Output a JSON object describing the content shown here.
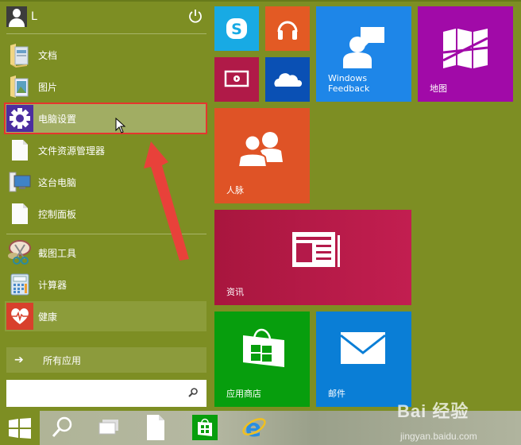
{
  "user": {
    "name": "L"
  },
  "pinned_items": [
    {
      "label": "文档",
      "icon": "documents-folder-icon"
    },
    {
      "label": "图片",
      "icon": "pictures-folder-icon"
    },
    {
      "label": "电脑设置",
      "icon": "gear-icon",
      "state": "selected"
    },
    {
      "label": "文件资源管理器",
      "icon": "document-icon"
    },
    {
      "label": "这台电脑",
      "icon": "computer-icon"
    },
    {
      "label": "控制面板",
      "icon": "document-icon"
    }
  ],
  "recent_items": [
    {
      "label": "截图工具",
      "icon": "scissors-icon"
    },
    {
      "label": "计算器",
      "icon": "calculator-icon"
    },
    {
      "label": "健康",
      "icon": "heart-icon",
      "state": "highlighted"
    }
  ],
  "all_apps": {
    "label": "所有应用"
  },
  "search": {
    "value": "",
    "placeholder": ""
  },
  "tiles": [
    {
      "id": "skype",
      "label": "",
      "color": "#18aae4",
      "icon": "skype-icon"
    },
    {
      "id": "music",
      "label": "",
      "color": "#e35a24",
      "icon": "headphones-icon"
    },
    {
      "id": "video",
      "label": "",
      "color": "#b01a48",
      "icon": "video-icon"
    },
    {
      "id": "onedrive",
      "label": "",
      "color": "#0a50b4",
      "icon": "cloud-icon"
    },
    {
      "id": "feedback",
      "label": "Windows Feedback",
      "color": "#1e86e8",
      "icon": "feedback-icon"
    },
    {
      "id": "maps",
      "label": "地图",
      "color": "#a10aa8",
      "icon": "map-icon"
    },
    {
      "id": "people",
      "label": "人脉",
      "color": "#df5326",
      "icon": "people-icon"
    },
    {
      "id": "news",
      "label": "资讯",
      "color": "#b41a4a",
      "icon": "news-icon"
    },
    {
      "id": "store",
      "label": "应用商店",
      "color": "#079e0d",
      "icon": "store-icon"
    },
    {
      "id": "mail",
      "label": "邮件",
      "color": "#0a7ed6",
      "icon": "mail-icon"
    }
  ],
  "taskbar": [
    {
      "name": "search",
      "icon": "search-icon"
    },
    {
      "name": "task-view",
      "icon": "task-view-icon"
    },
    {
      "name": "file",
      "icon": "document-icon"
    },
    {
      "name": "store",
      "icon": "store-icon"
    },
    {
      "name": "internet-explorer",
      "icon": "ie-icon"
    }
  ],
  "watermark": {
    "brand": "Bai 经验",
    "url": "jingyan.baidu.com"
  },
  "colors": {
    "start_bg": "#7d8e23",
    "selection_outline": "#e5362e",
    "selected_bg": "#a1ad63"
  }
}
